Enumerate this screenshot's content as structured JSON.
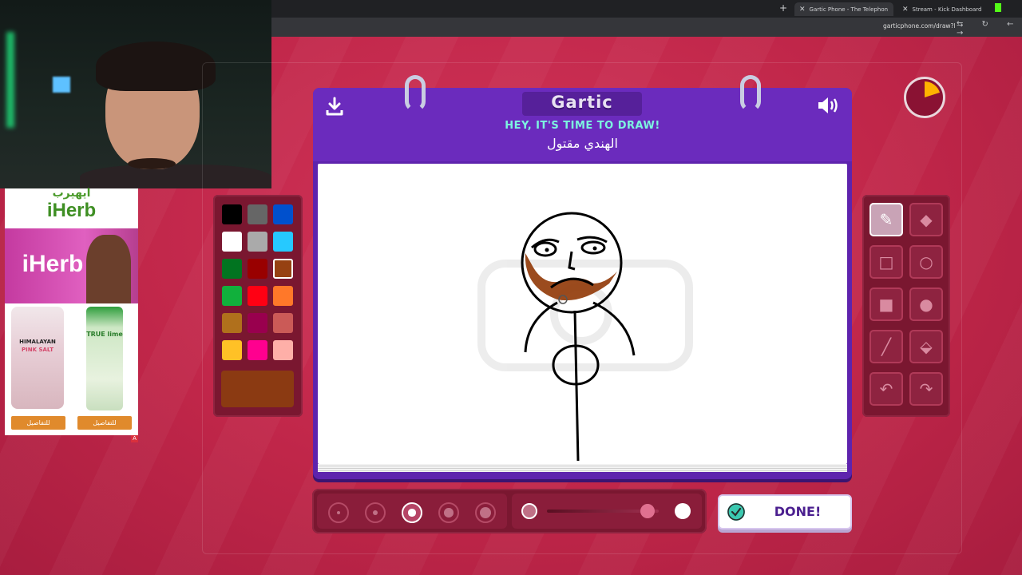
{
  "browser": {
    "tabs": [
      {
        "label": "Gartic Phone - The Telephon"
      },
      {
        "label": "Stream - Kick Dashboard"
      }
    ],
    "new_tab_glyph": "+",
    "close_glyph": "✕",
    "url": "garticphone.com/draw?l"
  },
  "ad": {
    "arabic_brand": "ايهيرب",
    "brand": "iHerb",
    "hero_text": "iHerb",
    "product1_label": "HIMALAYAN",
    "product1_label2": "PINK SALT",
    "product2_label": "TRUE lime",
    "button1": "للتفاصيل",
    "button2": "للتفاصيل",
    "ad_marker": "A"
  },
  "game": {
    "logo": "Gartic",
    "headline": "HEY, IT'S TIME TO DRAW!",
    "prompt": "الهندي مقتول",
    "done_label": "DONE!",
    "timer_fraction_elapsed": 0.2,
    "palette": [
      "#000000",
      "#666666",
      "#0050cd",
      "#ffffff",
      "#aaaaaa",
      "#26c9ff",
      "#017420",
      "#990000",
      "#964112",
      "#11b03c",
      "#ff0013",
      "#ff7829",
      "#b0701c",
      "#99004e",
      "#cb5a57",
      "#ffc126",
      "#ff008f",
      "#feafa8"
    ],
    "selected_color": "#964112",
    "current_color": "#8b3a12",
    "tools": [
      "pencil-icon",
      "eraser-icon",
      "rectangle-outline-icon",
      "ellipse-outline-icon",
      "rectangle-filled-icon",
      "ellipse-filled-icon",
      "line-icon",
      "fill-bucket-icon",
      "undo-icon",
      "redo-icon"
    ],
    "selected_tool": "pencil-icon",
    "brush_sizes": [
      1,
      2,
      3,
      4,
      5
    ],
    "selected_brush_size": 3,
    "opacity": 0.9
  }
}
